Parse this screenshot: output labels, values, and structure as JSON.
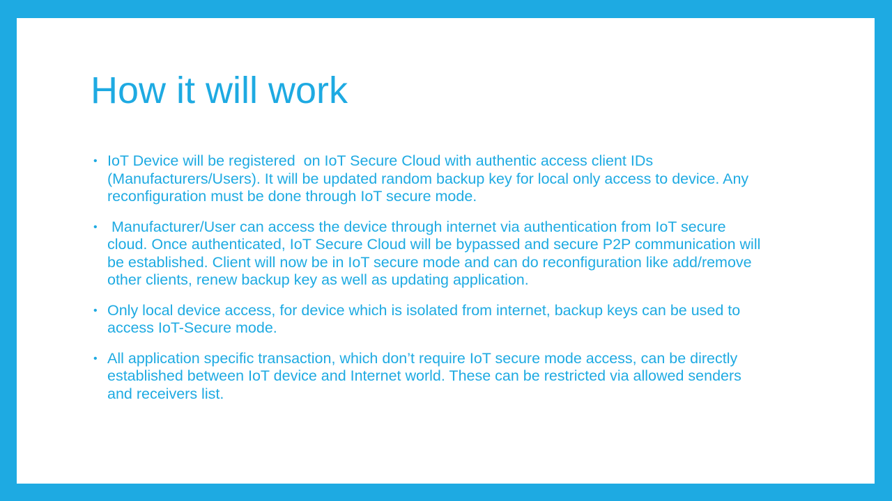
{
  "slide": {
    "title": "How it will work",
    "bullet_symbol": "•",
    "bullets": [
      "IoT Device will be registered  on IoT Secure Cloud with authentic access client IDs (Manufacturers/Users). It will be updated random backup key for local only access to device. Any reconfiguration must be done through IoT secure mode.",
      " Manufacturer/User can access the device through internet via authentication from IoT secure cloud. Once authenticated, IoT Secure Cloud will be bypassed and secure P2P communication will be established. Client will now be in IoT secure mode and can do reconfiguration like add/remove other clients, renew backup key as well as updating application.",
      "Only local device access, for device which is isolated from internet, backup keys can be used to access IoT-Secure mode.",
      "All application specific transaction, which don’t require IoT secure mode access, can be directly established between IoT device and Internet world. These can be restricted via allowed senders and receivers list."
    ]
  },
  "colors": {
    "accent": "#1eaae2",
    "background": "#ffffff"
  }
}
